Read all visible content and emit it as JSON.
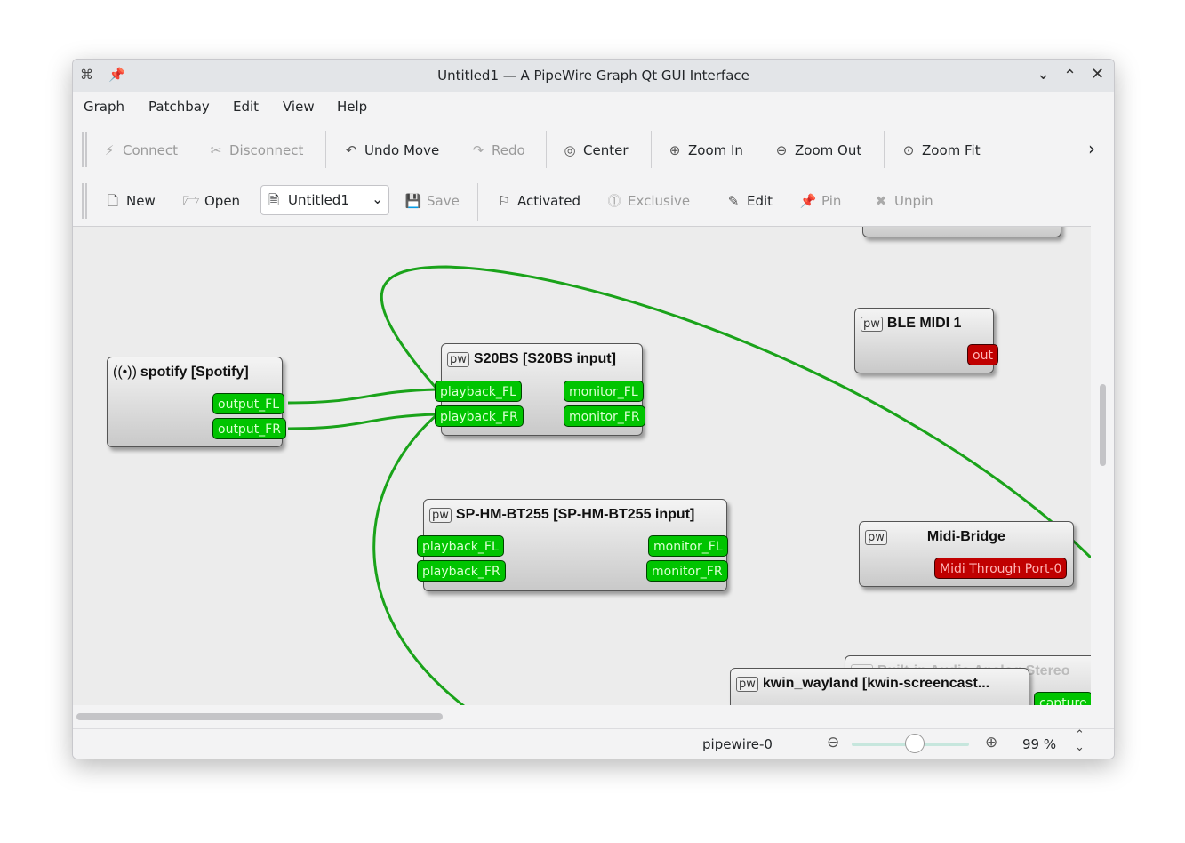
{
  "window": {
    "title": "Untitled1 — A PipeWire Graph Qt GUI Interface"
  },
  "menubar": [
    "Graph",
    "Patchbay",
    "Edit",
    "View",
    "Help"
  ],
  "toolbar1": {
    "connect": "Connect",
    "disconnect": "Disconnect",
    "undo_move": "Undo Move",
    "redo": "Redo",
    "center": "Center",
    "zoom_in": "Zoom In",
    "zoom_out": "Zoom Out",
    "zoom_fit": "Zoom Fit"
  },
  "toolbar2": {
    "new": "New",
    "open": "Open",
    "patchbay_select": "Untitled1",
    "save": "Save",
    "activated": "Activated",
    "exclusive": "Exclusive",
    "edit": "Edit",
    "pin": "Pin",
    "unpin": "Unpin"
  },
  "nodes": {
    "spotify": {
      "title": "spotify [Spotify]",
      "ports": [
        "output_FL",
        "output_FR"
      ]
    },
    "s20bs": {
      "title": "S20BS [S20BS input]",
      "in_ports": [
        "playback_FL",
        "playback_FR"
      ],
      "out_ports": [
        "monitor_FL",
        "monitor_FR"
      ]
    },
    "sphm": {
      "title": "SP-HM-BT255 [SP-HM-BT255 input]",
      "in_ports": [
        "playback_FL",
        "playback_FR"
      ],
      "out_ports": [
        "monitor_FL",
        "monitor_FR"
      ]
    },
    "ble_midi": {
      "title": "BLE MIDI 1",
      "ports": [
        "out"
      ]
    },
    "midi_bridge": {
      "title": "Midi-Bridge",
      "ports": [
        "Midi Through Port-0"
      ]
    },
    "builtin_audio": {
      "title": "Built-in Audio Analog Stereo",
      "ports": [
        "capture"
      ]
    },
    "kwin": {
      "title": "kwin_wayland [kwin-screencast..."
    }
  },
  "pw_badge": "pw",
  "status": {
    "server": "pipewire-0",
    "zoom": "99 %"
  },
  "zoom_level_percent": 99,
  "colors": {
    "audio_port": "#00c400",
    "midi_port": "#c00000",
    "link": "#1aa31a"
  }
}
